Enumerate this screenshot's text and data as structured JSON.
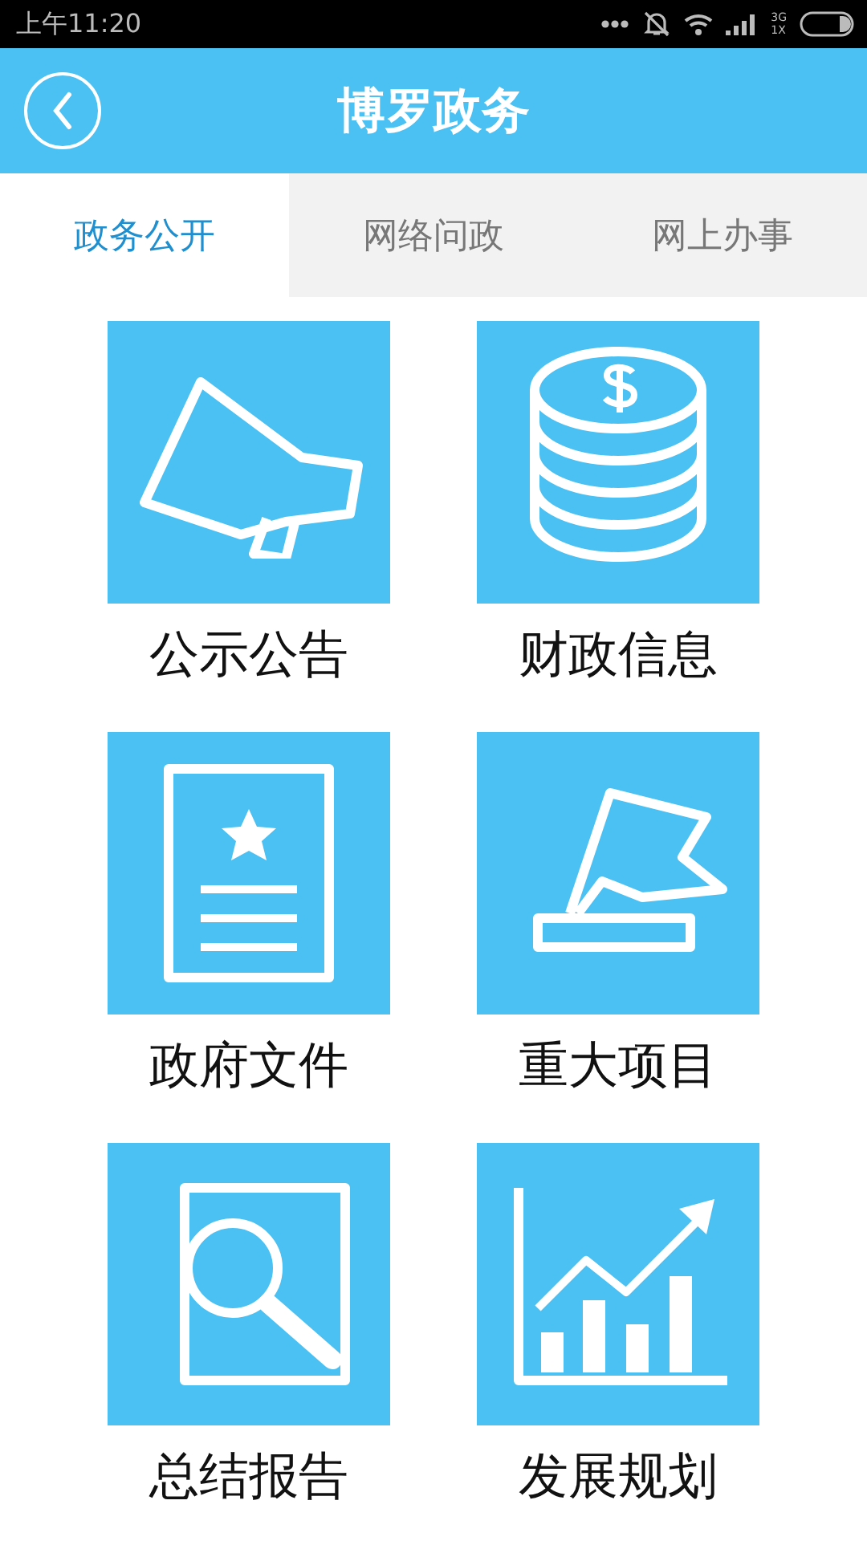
{
  "status_bar": {
    "time": "上午11:20",
    "network_top": "3G",
    "network_bottom": "1X"
  },
  "header": {
    "title": "博罗政务"
  },
  "tabs": [
    {
      "label": "政务公开",
      "selected": true
    },
    {
      "label": "网络问政",
      "selected": false
    },
    {
      "label": "网上办事",
      "selected": false
    }
  ],
  "tiles": [
    {
      "label": "公示公告",
      "kind": "megaphone"
    },
    {
      "label": "财政信息",
      "kind": "coins"
    },
    {
      "label": "政府文件",
      "kind": "document"
    },
    {
      "label": "重大项目",
      "kind": "flag"
    },
    {
      "label": "总结报告",
      "kind": "magnifier"
    },
    {
      "label": "发展规划",
      "kind": "chart"
    }
  ]
}
